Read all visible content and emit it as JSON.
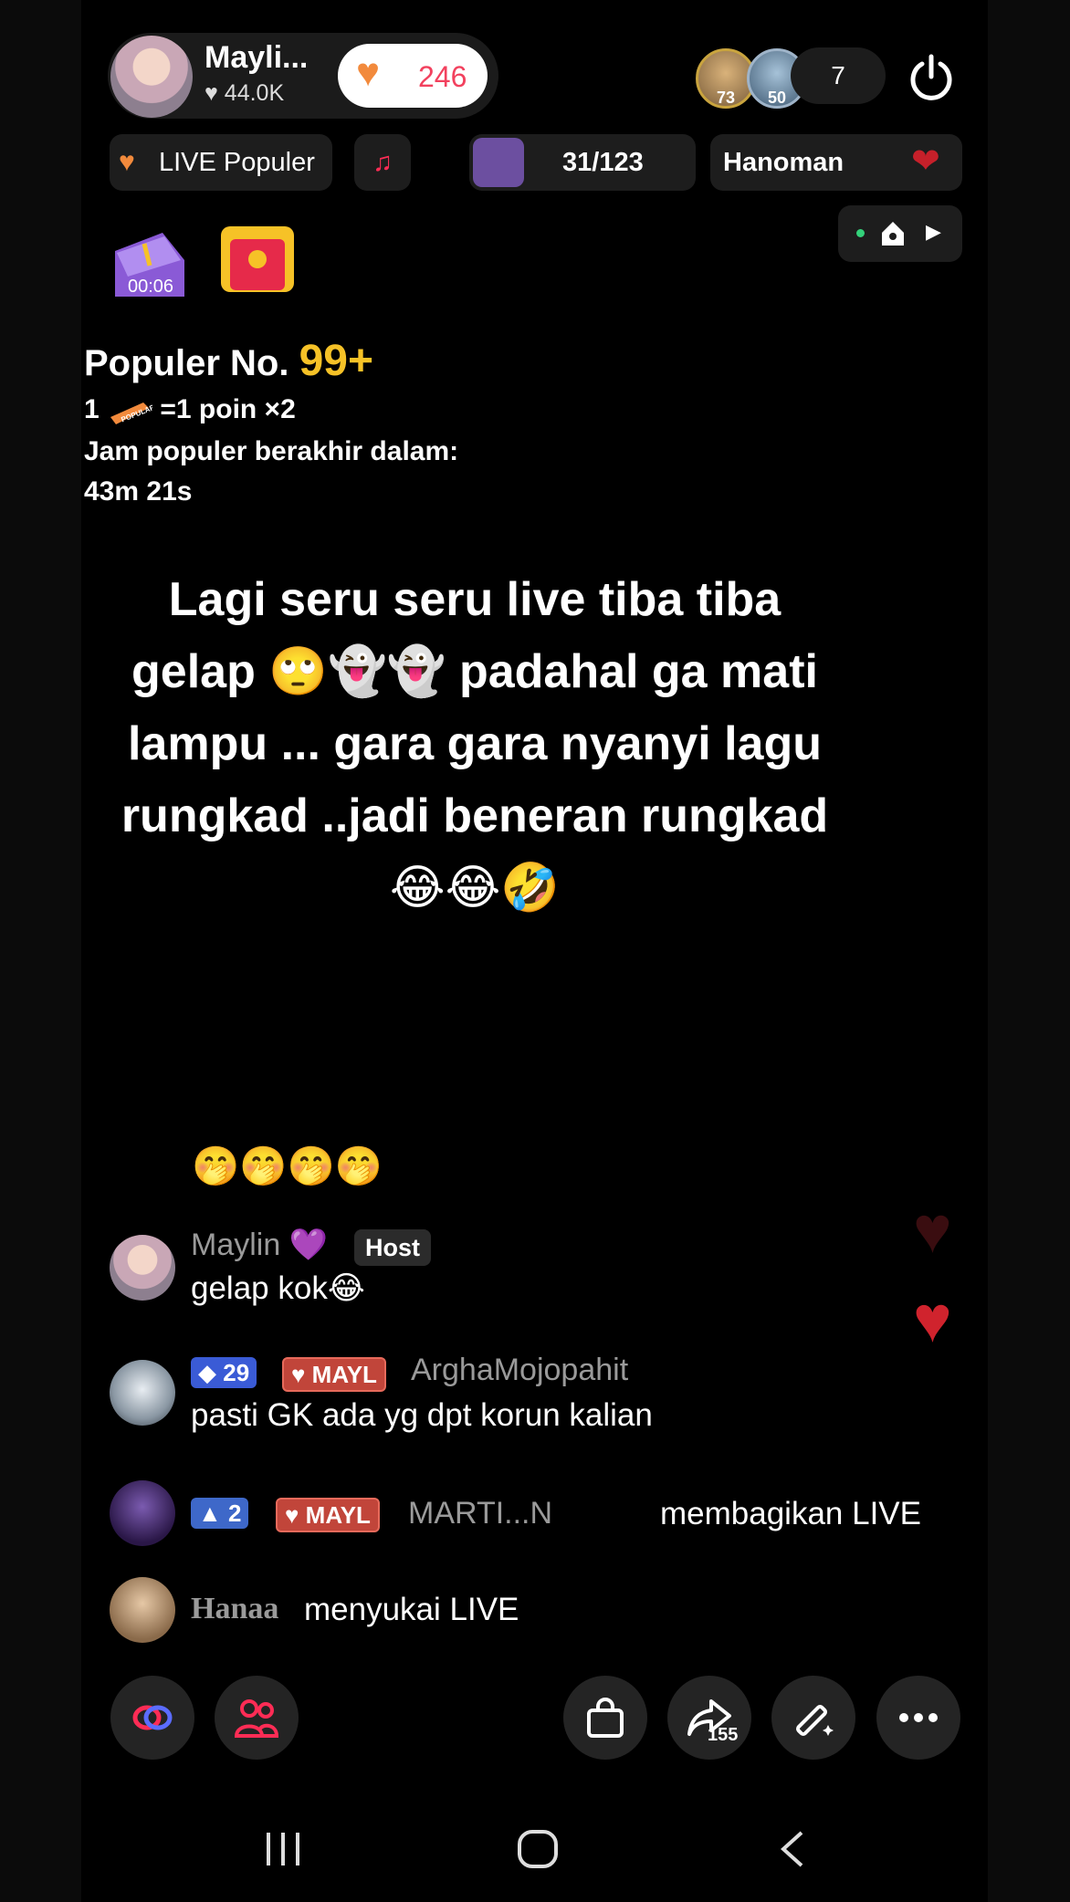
{
  "header": {
    "host_name": "Mayli...",
    "host_likes": "44.0K",
    "like_count": "246",
    "viewer_badges": [
      "73",
      "50"
    ],
    "viewer_count": "7"
  },
  "chips": {
    "live_popular": "LIVE Populer",
    "rank_progress": "31/123",
    "ticker_text": "Hanoman"
  },
  "event": {
    "timer": "00:06"
  },
  "popular": {
    "title_prefix": "Populer No.",
    "title_rank": "99+",
    "line1_prefix": "1",
    "line1_suffix": "=1 poin ×2",
    "line1_icon_label": "POPULAR",
    "line2": "Jam populer berakhir dalam:",
    "line3": "43m 21s"
  },
  "caption": "Lagi seru seru live tiba tiba gelap 🙄👻👻 padahal ga mati lampu ... gara gara nyanyi lagu rungkad ..jadi beneran rungkad 😂😂🤣",
  "chat": {
    "emoji_row": "🤭🤭🤭🤭",
    "messages": [
      {
        "user": "Maylin 💜",
        "tag": "Host",
        "text": "gelap kok😂"
      },
      {
        "level": "29",
        "fanclub": "MAYL",
        "user": "ArghaMojopahit",
        "text": "pasti GK ada yg dpt korun kalian"
      },
      {
        "level": "2",
        "fanclub": "MAYL",
        "user": "MARTI...N",
        "text": "membagikan LIVE"
      },
      {
        "user": "Hanaa",
        "text": "menyukai LIVE"
      }
    ]
  },
  "toolbar": {
    "share_count": "155"
  },
  "colors": {
    "accent_pink": "#fe2c55",
    "gold": "#f6c227",
    "like_orange": "#f28a3c"
  }
}
